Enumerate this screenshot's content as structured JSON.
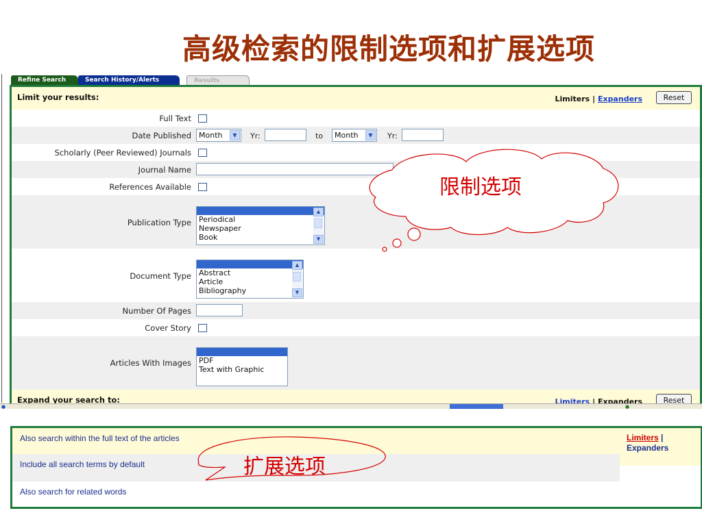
{
  "slide": {
    "title": "高级检索的限制选项和扩展选项"
  },
  "tabs": [
    "Refine Search",
    "Search History/Alerts",
    "Results"
  ],
  "limit_header": {
    "title": "Limit your results:",
    "limiters": "Limiters",
    "divider": "|",
    "expanders": "Expanders",
    "reset": "Reset"
  },
  "fields": {
    "full_text": "Full Text",
    "date_published": "Date Published",
    "month1": "Month",
    "yr_label1": "Yr:",
    "to_label": "to",
    "month2": "Month",
    "yr_label2": "Yr:",
    "scholarly": "Scholarly (Peer Reviewed) Journals",
    "journal_name": "Journal Name",
    "references": "References Available",
    "publication_type": "Publication Type",
    "publication_options": [
      "Periodical",
      "Newspaper",
      "Book"
    ],
    "document_type": "Document Type",
    "document_options": [
      "Abstract",
      "Article",
      "Bibliography"
    ],
    "number_of_pages": "Number Of Pages",
    "cover_story": "Cover Story",
    "articles_with_images": "Articles With Images",
    "image_options": [
      "PDF",
      "Text with Graphic"
    ]
  },
  "expand_header": {
    "title": "Expand your search to:",
    "limiters": "Limiters",
    "divider": "|",
    "expanders": "Expanders",
    "reset": "Reset"
  },
  "expanders": {
    "rows": [
      "Also search within the full text of the articles",
      "Include all search terms by default",
      "Also search for related words"
    ],
    "limiters_link": "Limiters",
    "divider": "|",
    "expanders_link": "Expanders"
  },
  "callouts": {
    "limiters_note": "限制选项",
    "expanders_note": "扩展选项"
  },
  "colors": {
    "title": "#9c2f06",
    "panel_border": "#1e7b3c",
    "callout": "#d40000",
    "header_row": "#fffbd6",
    "link": "#1b3fc8"
  }
}
